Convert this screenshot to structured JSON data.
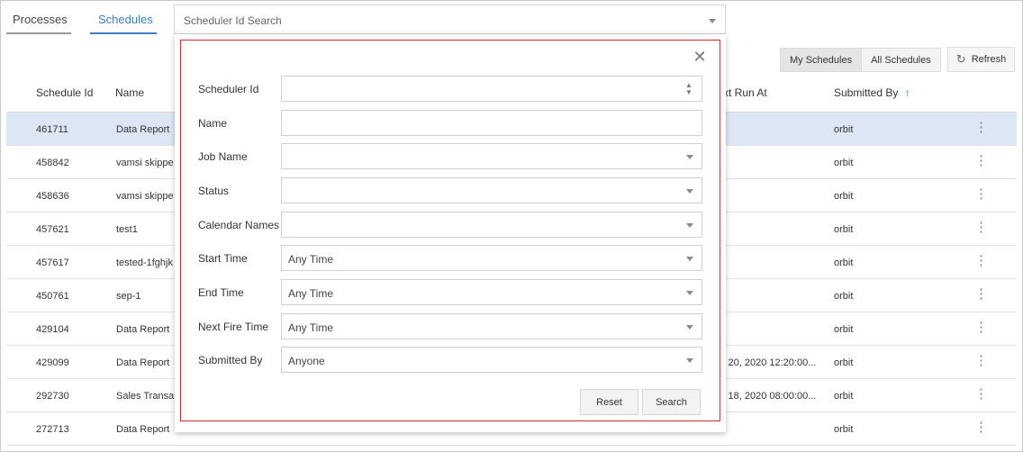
{
  "tabs": {
    "processes": "Processes",
    "schedules": "Schedules"
  },
  "search": {
    "placeholder": "Scheduler Id Search"
  },
  "toolbar": {
    "my_schedules": "My Schedules",
    "all_schedules": "All Schedules",
    "refresh": "Refresh"
  },
  "table": {
    "headers": {
      "schedule_id": "Schedule Id",
      "name": "Name",
      "next_run_at": "xt Run At",
      "submitted_by": "Submitted By"
    },
    "rows": [
      {
        "id": "461711",
        "name": "Data Report",
        "next": "",
        "by": "orbit"
      },
      {
        "id": "458842",
        "name": "vamsi skippe",
        "next": "",
        "by": "orbit"
      },
      {
        "id": "458636",
        "name": "vamsi skippe",
        "next": "",
        "by": "orbit"
      },
      {
        "id": "457621",
        "name": "test1",
        "next": "",
        "by": "orbit"
      },
      {
        "id": "457617",
        "name": "tested-1fghjk",
        "next": "",
        "by": "orbit"
      },
      {
        "id": "450761",
        "name": "sep-1",
        "next": "",
        "by": "orbit"
      },
      {
        "id": "429104",
        "name": "Data Report",
        "next": "",
        "by": "orbit"
      },
      {
        "id": "429099",
        "name": "Data Report",
        "next": "j 20, 2020 12:20:00...",
        "by": "orbit"
      },
      {
        "id": "292730",
        "name": "Sales Transa",
        "next": "j 18, 2020 08:00:00...",
        "by": "orbit"
      },
      {
        "id": "272713",
        "name": "Data Report",
        "next": "",
        "by": "orbit"
      }
    ]
  },
  "filter": {
    "fields": [
      {
        "label": "Scheduler Id",
        "value": "",
        "kind": "number"
      },
      {
        "label": "Name",
        "value": "",
        "kind": "text"
      },
      {
        "label": "Job Name",
        "value": "",
        "kind": "select"
      },
      {
        "label": "Status",
        "value": "",
        "kind": "select"
      },
      {
        "label": "Calendar Names",
        "value": "",
        "kind": "select"
      },
      {
        "label": "Start Time",
        "value": "Any Time",
        "kind": "select"
      },
      {
        "label": "End Time",
        "value": "Any Time",
        "kind": "select"
      },
      {
        "label": "Next Fire Time",
        "value": "Any Time",
        "kind": "select"
      },
      {
        "label": "Submitted By",
        "value": "Anyone",
        "kind": "select"
      }
    ],
    "reset": "Reset",
    "search": "Search",
    "close_icon": "close-icon"
  },
  "colors": {
    "accent": "#3a7fc1",
    "selected_row": "#dde6f5",
    "popup_border": "#d62b2b"
  }
}
